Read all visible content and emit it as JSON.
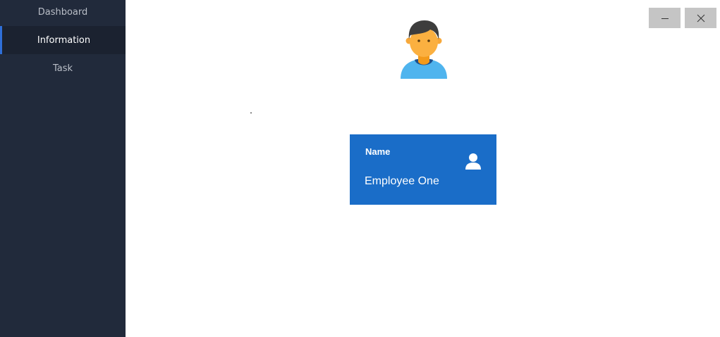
{
  "sidebar": {
    "items": [
      {
        "label": "Dashboard",
        "active": false
      },
      {
        "label": "Information",
        "active": true
      },
      {
        "label": "Task",
        "active": false
      }
    ]
  },
  "window_controls": {
    "minimize_icon": "minimize-icon",
    "close_icon": "close-icon"
  },
  "profile": {
    "avatar_icon": "user-avatar-icon"
  },
  "info_card": {
    "label": "Name",
    "value": "Employee One",
    "icon": "person-icon"
  },
  "colors": {
    "sidebar_bg": "#212a3b",
    "active_indicator": "#2f6fd8",
    "card_bg": "#1a6dc8"
  }
}
